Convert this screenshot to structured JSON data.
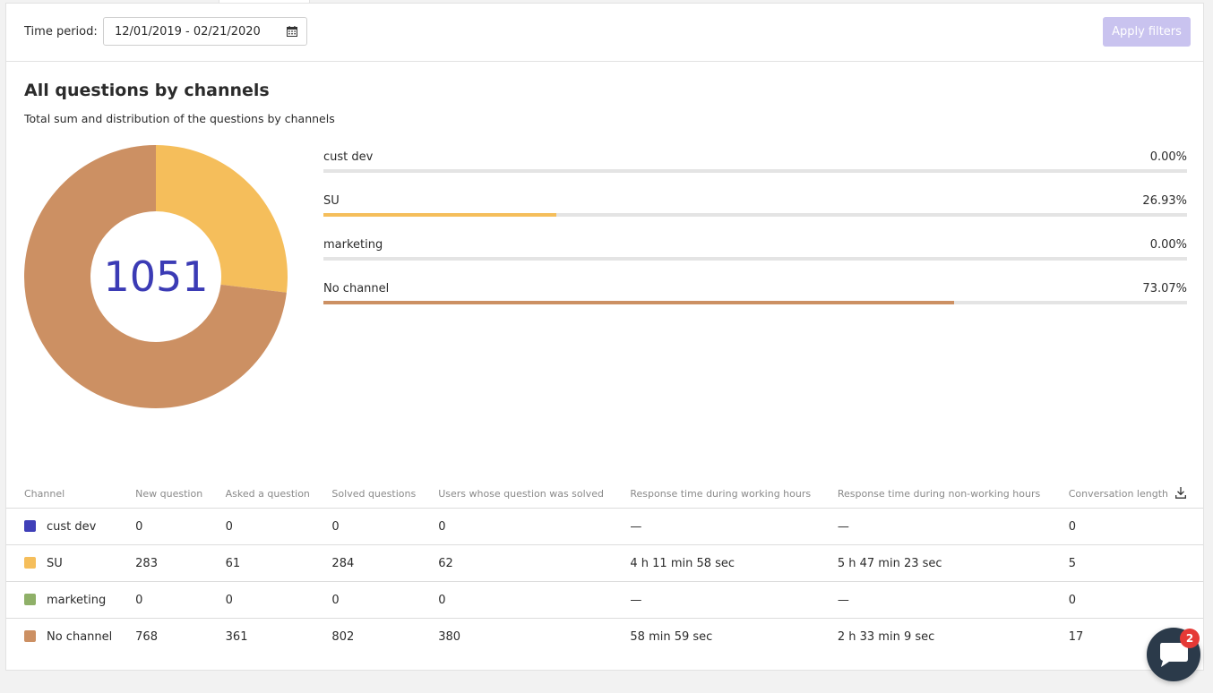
{
  "filters": {
    "time_period_label": "Time period:",
    "date_range": "12/01/2019 - 02/21/2020",
    "apply_label": "Apply filters"
  },
  "section": {
    "title": "All questions by channels",
    "subtitle": "Total sum and distribution of the questions by channels"
  },
  "chart_data": {
    "type": "pie",
    "center_total": "1051",
    "slices": [
      {
        "name": "cust dev",
        "percent": 0.0,
        "percent_label": "0.00%",
        "color": "#3f3fb8"
      },
      {
        "name": "SU",
        "percent": 26.93,
        "percent_label": "26.93%",
        "color": "#f5be5b"
      },
      {
        "name": "marketing",
        "percent": 0.0,
        "percent_label": "0.00%",
        "color": "#8fb068"
      },
      {
        "name": "No channel",
        "percent": 73.07,
        "percent_label": "73.07%",
        "color": "#cc9063"
      }
    ]
  },
  "table": {
    "headers": [
      "Channel",
      "New question",
      "Asked a question",
      "Solved questions",
      "Users whose question was solved",
      "Response time during working hours",
      "Response time during non-working hours",
      "Conversation length"
    ],
    "rows": [
      {
        "channel": "cust dev",
        "color": "#3f3fb8",
        "cells": [
          "0",
          "0",
          "0",
          "0",
          "—",
          "—",
          "0"
        ]
      },
      {
        "channel": "SU",
        "color": "#f5be5b",
        "cells": [
          "283",
          "61",
          "284",
          "62",
          "4 h 11 min 58 sec",
          "5 h 47 min 23 sec",
          "5"
        ]
      },
      {
        "channel": "marketing",
        "color": "#8fb068",
        "cells": [
          "0",
          "0",
          "0",
          "0",
          "—",
          "—",
          "0"
        ]
      },
      {
        "channel": "No channel",
        "color": "#cc9063",
        "cells": [
          "768",
          "361",
          "802",
          "380",
          "58 min 59 sec",
          "2 h 33 min 9 sec",
          "17"
        ]
      }
    ]
  },
  "icons": {
    "calendar": "calendar-icon",
    "download": "download-icon",
    "chat": "chat-icon"
  },
  "chat": {
    "badge_count": "2"
  }
}
